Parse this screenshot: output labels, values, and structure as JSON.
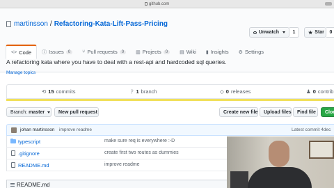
{
  "browser": {
    "url": "github.com"
  },
  "repo": {
    "owner": "martinsson",
    "separator": "/",
    "name": "Refactoring-Kata-Lift-Pass-Pricing",
    "unwatch_label": "Unwatch",
    "watch_count": "1",
    "star_label": "Star",
    "star_count": "0"
  },
  "tabs": [
    {
      "label": "Code",
      "icon": "code-icon",
      "count": ""
    },
    {
      "label": "Issues",
      "icon": "issue-icon",
      "count": "0"
    },
    {
      "label": "Pull requests",
      "icon": "pull-request-icon",
      "count": "0"
    },
    {
      "label": "Projects",
      "icon": "project-icon",
      "count": "0"
    },
    {
      "label": "Wiki",
      "icon": "wiki-icon",
      "count": ""
    },
    {
      "label": "Insights",
      "icon": "graph-icon",
      "count": ""
    },
    {
      "label": "Settings",
      "icon": "gear-icon",
      "count": ""
    }
  ],
  "description": "A refactoring kata where you have to deal with a rest-api and hardcoded sql queries.",
  "manage_topics": "Manage topics",
  "summary": {
    "commits_count": "15",
    "commits_label": "commits",
    "branches_count": "1",
    "branches_label": "branch",
    "releases_count": "0",
    "releases_label": "releases",
    "contributors_count": "0",
    "contributors_label": "contrib"
  },
  "toolbar": {
    "branch_label": "Branch:",
    "branch_value": "master",
    "new_pull_request": "New pull request",
    "create_new_file": "Create new file",
    "upload_files": "Upload files",
    "find_file": "Find file",
    "clone": "Clon"
  },
  "commit": {
    "author": "johan martinsson",
    "message": "improve readme",
    "latest": "Latest commit 4dec"
  },
  "files": [
    {
      "name": "typescript",
      "type": "folder",
      "commit": "make sure req is everywhere :-D"
    },
    {
      "name": ".gitignore",
      "type": "file",
      "commit": "create first two routes as dummies"
    },
    {
      "name": "README.md",
      "type": "file",
      "commit": "improve readme"
    }
  ],
  "readme": {
    "title": "README.md"
  },
  "colors": {
    "link": "#0366d6",
    "selected_tab_accent": "#e36209",
    "clone_button": "#28a745",
    "language_bar": "#f1e05a"
  }
}
